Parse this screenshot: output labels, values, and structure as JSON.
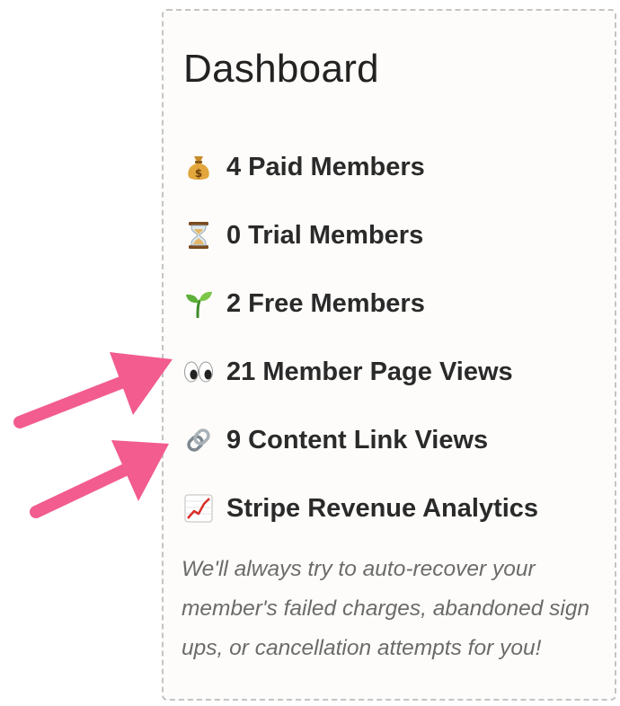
{
  "dashboard": {
    "title": "Dashboard",
    "stats": [
      {
        "icon": "money-bag-icon",
        "label": "4 Paid Members"
      },
      {
        "icon": "hourglass-icon",
        "label": "0 Trial Members"
      },
      {
        "icon": "seedling-icon",
        "label": "2 Free Members"
      },
      {
        "icon": "eyes-icon",
        "label": "21 Member Page Views"
      },
      {
        "icon": "link-icon",
        "label": "9 Content Link Views"
      },
      {
        "icon": "chart-increasing-icon",
        "label": "Stripe Revenue Analytics"
      }
    ],
    "note": "We'll always try to auto-recover your member's failed charges, abandoned sign ups, or cancellation attempts for you!"
  },
  "annotations": {
    "arrow_color": "#f25c8f",
    "arrows": [
      "points-to-member-page-views",
      "points-to-content-link-views"
    ]
  },
  "colors": {
    "panel_background": "#fdfcfa",
    "panel_border": "#c4c4c4",
    "text_dark": "#2a2a2a",
    "note_text": "#6b6b6b"
  }
}
